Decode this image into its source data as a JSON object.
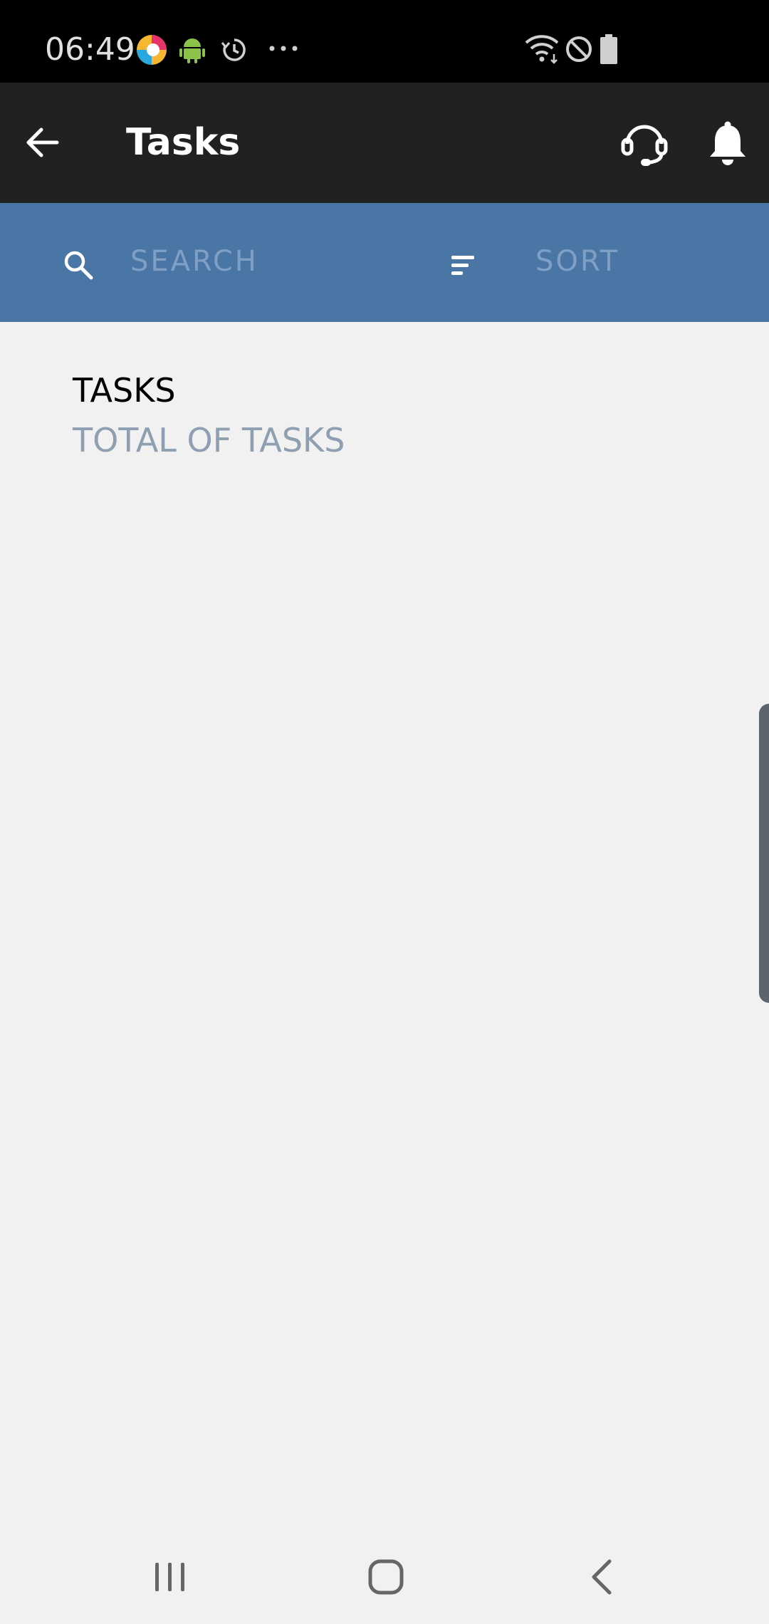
{
  "status_bar": {
    "time": "06:49",
    "left_icons": [
      "color-app-icon",
      "android-icon",
      "sync-icon",
      "more-dots-icon"
    ],
    "right_icons": [
      "wifi-icon",
      "do-not-disturb-icon",
      "battery-icon"
    ]
  },
  "app_bar": {
    "title": "Tasks",
    "back_icon": "arrow-back-icon",
    "support_icon": "headset-icon",
    "notifications_icon": "bell-icon"
  },
  "search_bar": {
    "search_placeholder": "SEARCH",
    "sort_label": "SORT",
    "background_color": "#4a76a6"
  },
  "content": {
    "section_title": "TASKS",
    "section_subtitle": "TOTAL OF TASKS"
  },
  "nav_bar": {
    "recents_icon": "recents-icon",
    "home_icon": "home-icon",
    "back_icon": "back-chevron-icon"
  }
}
